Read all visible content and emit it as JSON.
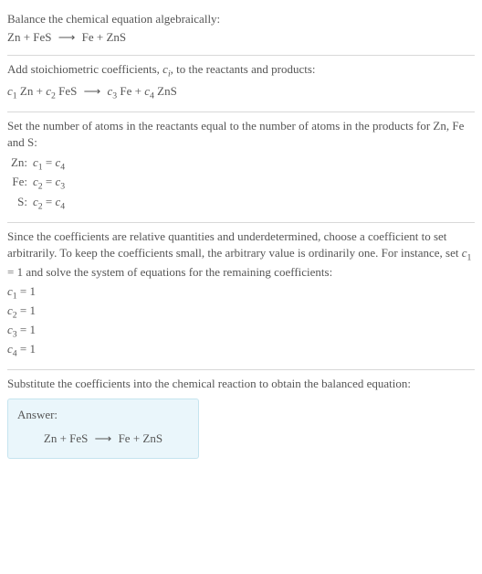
{
  "sections": {
    "intro": {
      "header": "Balance the chemical equation algebraically:",
      "equation_left": "Zn + FeS",
      "arrow": "⟶",
      "equation_right": "Fe + ZnS"
    },
    "stoich": {
      "text_before_ci": "Add stoichiometric coefficients, ",
      "ci": "c",
      "ci_sub": "i",
      "text_after_ci": ", to the reactants and products:",
      "eq_c1": "c",
      "eq_c1_sub": "1",
      "eq_sp1": " Zn + ",
      "eq_c2": "c",
      "eq_c2_sub": "2",
      "eq_sp2": " FeS",
      "arrow": "⟶",
      "eq_c3": "c",
      "eq_c3_sub": "3",
      "eq_sp3": " Fe + ",
      "eq_c4": "c",
      "eq_c4_sub": "4",
      "eq_sp4": " ZnS"
    },
    "atoms": {
      "header": "Set the number of atoms in the reactants equal to the number of atoms in the products for Zn, Fe and S:",
      "rows": [
        {
          "label": "Zn:",
          "ca": "c",
          "ca_sub": "1",
          "eq": " = ",
          "cb": "c",
          "cb_sub": "4"
        },
        {
          "label": "Fe:",
          "ca": "c",
          "ca_sub": "2",
          "eq": " = ",
          "cb": "c",
          "cb_sub": "3"
        },
        {
          "label": "S:",
          "ca": "c",
          "ca_sub": "2",
          "eq": " = ",
          "cb": "c",
          "cb_sub": "4"
        }
      ]
    },
    "solve": {
      "text_before": "Since the coefficients are relative quantities and underdetermined, choose a coefficient to set arbitrarily. To keep the coefficients small, the arbitrary value is ordinarily one. For instance, set ",
      "c1": "c",
      "c1_sub": "1",
      "text_mid": " = 1 and solve the system of equations for the remaining coefficients:",
      "coeffs": [
        {
          "c": "c",
          "sub": "1",
          "val": " = 1"
        },
        {
          "c": "c",
          "sub": "2",
          "val": " = 1"
        },
        {
          "c": "c",
          "sub": "3",
          "val": " = 1"
        },
        {
          "c": "c",
          "sub": "4",
          "val": " = 1"
        }
      ]
    },
    "substitute": {
      "text": "Substitute the coefficients into the chemical reaction to obtain the balanced equation:"
    },
    "answer": {
      "label": "Answer:",
      "equation_left": "Zn + FeS",
      "arrow": "⟶",
      "equation_right": "Fe + ZnS"
    }
  }
}
